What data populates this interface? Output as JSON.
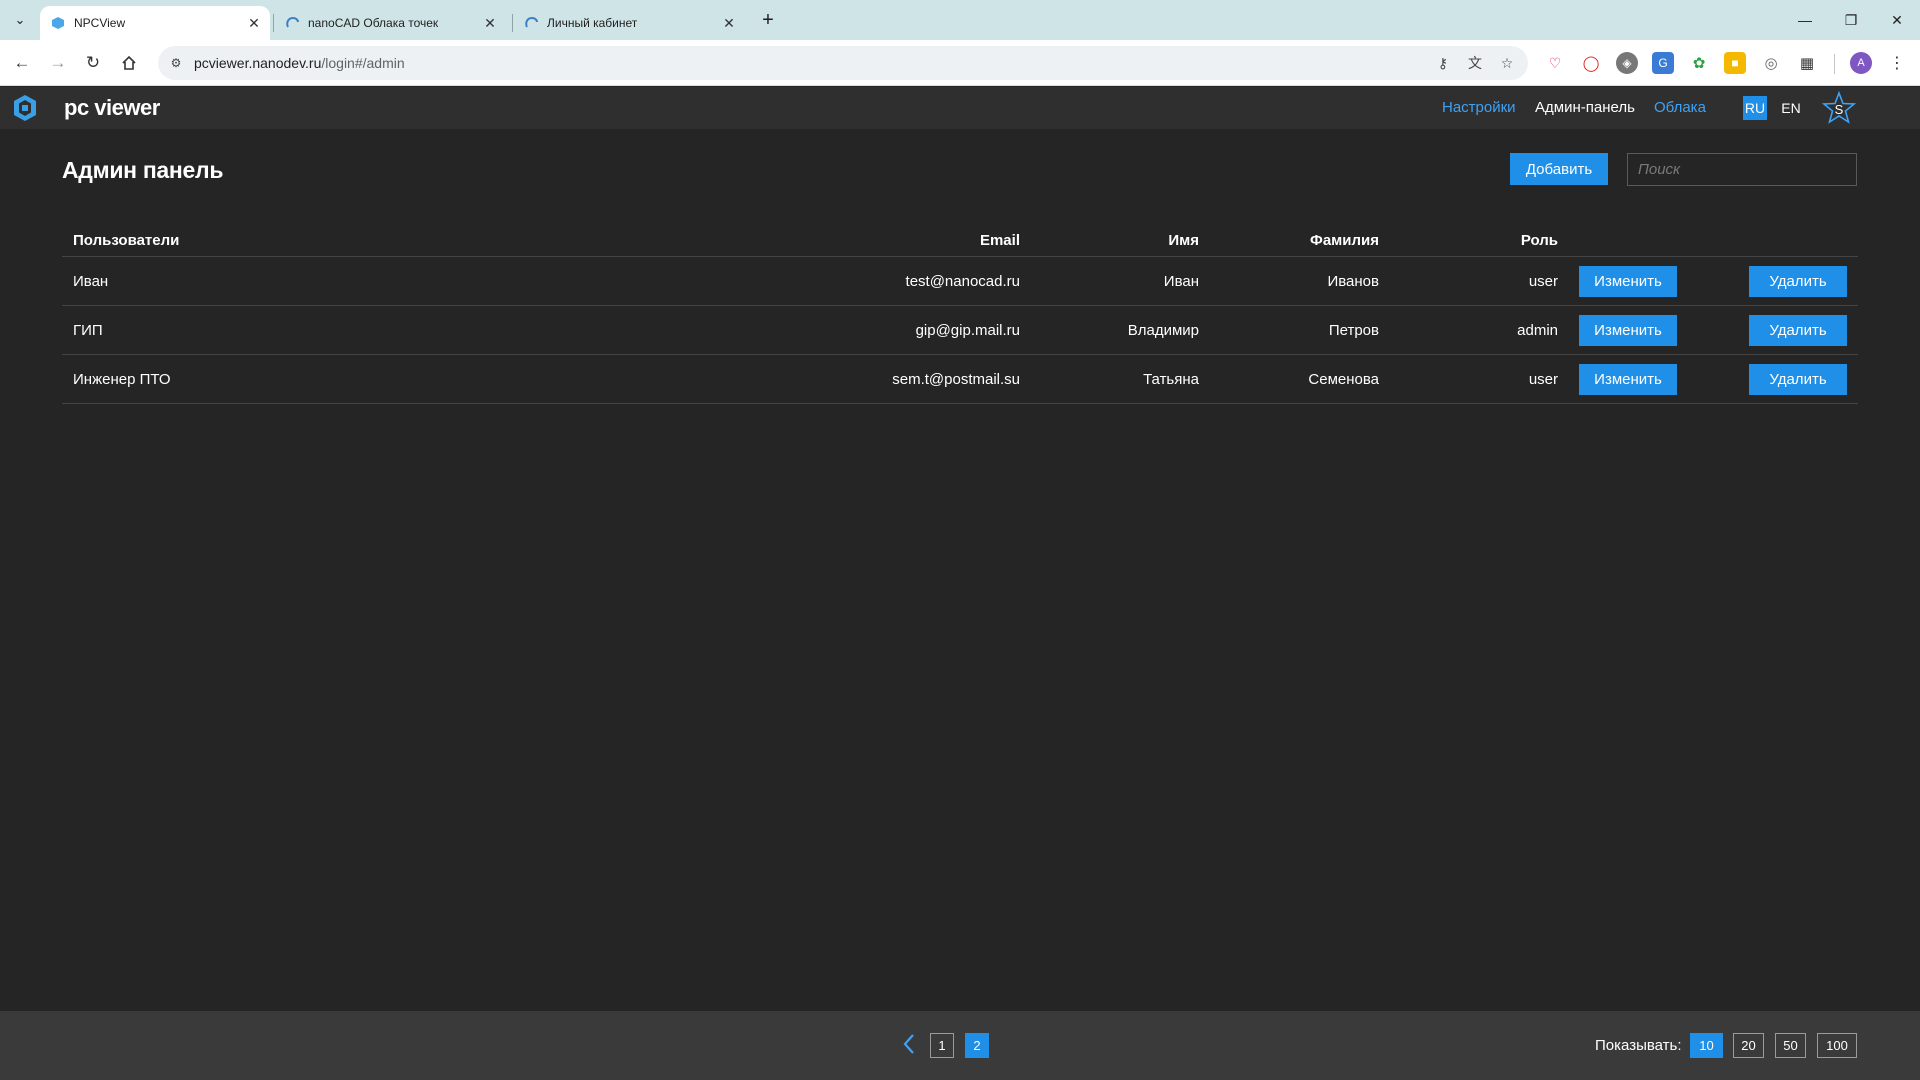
{
  "browser": {
    "tabs": [
      {
        "title": "NPCView",
        "favicon": "pcviewer-icon",
        "active": true
      },
      {
        "title": "nanoCAD Облака точек",
        "favicon": "nanocad-icon",
        "active": false
      },
      {
        "title": "Личный кабинет",
        "favicon": "nanocad-icon",
        "active": false
      }
    ],
    "url_host": "pcviewer.nanodev.ru",
    "url_path": "/login#/admin",
    "profile_initial": "A"
  },
  "app": {
    "logo_text": "pc viewer",
    "nav": {
      "settings": "Настройки",
      "admin": "Админ-панель",
      "clouds": "Облака"
    },
    "lang": {
      "ru": "RU",
      "en": "EN"
    },
    "user_initial": "S",
    "accent_color": "#1f8fe8"
  },
  "page": {
    "title": "Админ панель",
    "add_label": "Добавить",
    "search_placeholder": "Поиск"
  },
  "table": {
    "headers": {
      "user": "Пользователи",
      "email": "Email",
      "first_name": "Имя",
      "last_name": "Фамилия",
      "role": "Роль"
    },
    "edit_label": "Изменить",
    "delete_label": "Удалить",
    "rows": [
      {
        "user": "Иван",
        "email": "test@nanocad.ru",
        "first_name": "Иван",
        "last_name": "Иванов",
        "role": "user"
      },
      {
        "user": "ГИП",
        "email": "gip@gip.mail.ru",
        "first_name": "Владимир",
        "last_name": "Петров",
        "role": "admin"
      },
      {
        "user": "Инженер ПТО",
        "email": "sem.t@postmail.su",
        "first_name": "Татьяна",
        "last_name": "Семенова",
        "role": "user"
      }
    ]
  },
  "pagination": {
    "pages": [
      "1",
      "2"
    ],
    "current_page": "2",
    "show_label": "Показывать:",
    "page_sizes": [
      "10",
      "20",
      "50",
      "100"
    ],
    "current_size": "10"
  }
}
